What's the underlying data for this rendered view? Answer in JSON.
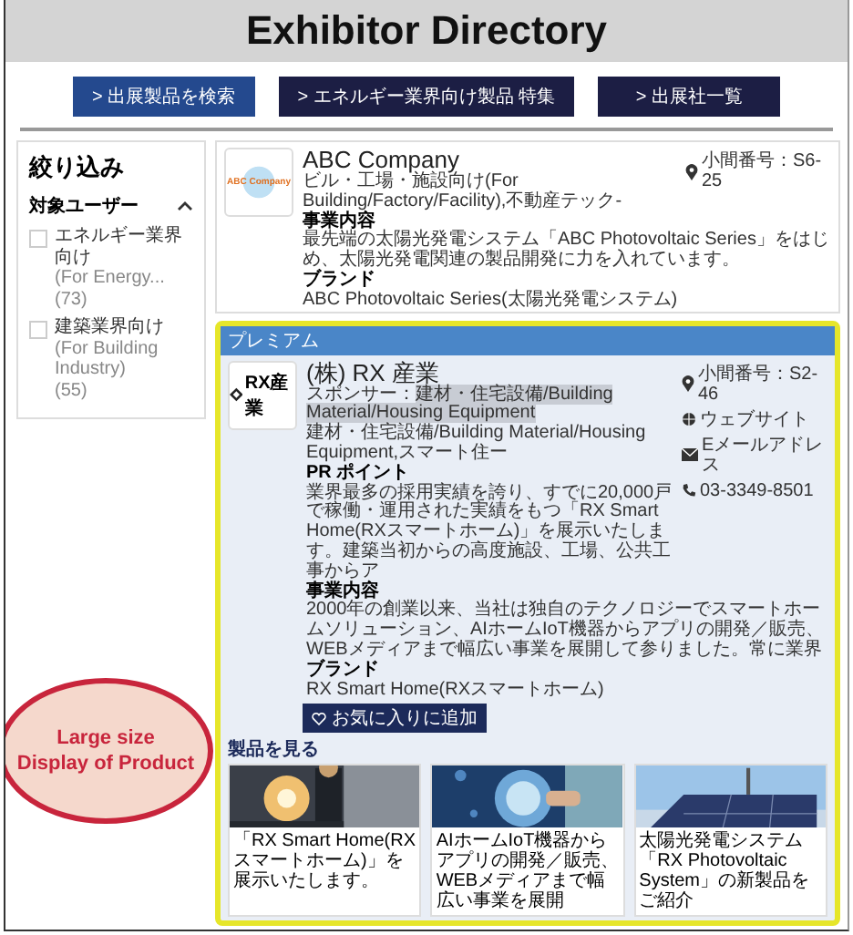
{
  "header": {
    "title": "Exhibitor Directory"
  },
  "nav_buttons": [
    {
      "label": "> 出展製品を検索",
      "selected": true
    },
    {
      "label": "> エネルギー業界向け製品 特集",
      "selected": false
    },
    {
      "label": "> 出展社一覧",
      "selected": false
    }
  ],
  "filter": {
    "title": "絞り込み",
    "section": "対象ユーザー",
    "options": [
      {
        "label": "エネルギー業界向け",
        "sub": "(For Energy...",
        "count": "(73)",
        "checked": false
      },
      {
        "label": "建築業界向け",
        "sub": "(For Building Industry)",
        "count": "(55)",
        "checked": false
      }
    ]
  },
  "exhibitors": [
    {
      "kind": "standard",
      "logo": "ABC Company",
      "name": "ABC Company",
      "tags": "ビル・工場・施設向け(For Building/Factory/Facility),不動産テック-",
      "sections": [
        {
          "heading": "事業内容",
          "text": "最先端の太陽光発電システム「ABC Photovoltaic Series」をはじめ、太陽光発電関連の製品開発に力を入れています。"
        },
        {
          "heading": "ブランド",
          "text": "ABC Photovoltaic Series(太陽光発電システム)"
        }
      ],
      "contacts": [
        {
          "kind": "location",
          "text": "小間番号：S6-25"
        }
      ]
    },
    {
      "kind": "premium",
      "badge": "プレミアム",
      "logo": "RX産業",
      "name": "(株) RX 産業",
      "sponsor": {
        "label": "スポンサー：",
        "value": "建材・住宅設備/Building Material/Housing Equipment"
      },
      "tags": "建材・住宅設備/Building Material/Housing Equipment,スマート住ー",
      "sections": [
        {
          "heading": "PR ポイント",
          "text": "業界最多の採用実績を誇り、すでに20,000戸で稼働・運用された実績をもつ「RX Smart Home(RXスマートホーム)」を展示いたします。建築当初からの高度施設、工場、公共工事からア"
        },
        {
          "heading": "事業内容",
          "text": "2000年の創業以来、当社は独自のテクノロジーでスマートホームソリューション、AIホームIoT機器からアプリの開発／販売、WEBメディアまで幅広い事業を展開して参りました。常に業界"
        },
        {
          "heading": "ブランド",
          "text": "RX Smart Home(RXスマートホーム)"
        }
      ],
      "contacts": [
        {
          "kind": "location",
          "text": "小間番号：S2-46"
        },
        {
          "kind": "website",
          "text": "ウェブサイト"
        },
        {
          "kind": "email",
          "text": "Eメールアドレス"
        },
        {
          "kind": "phone",
          "text": "03-3349-8501"
        }
      ],
      "favorite_button": "お気に入りに追加",
      "products_heading": "製品を見る",
      "products": [
        {
          "caption": "「RX Smart Home(RXスマートホーム)」を展示いたします。"
        },
        {
          "caption": "AIホームIoT機器からアプリの開発／販売、WEBメディアまで幅広い事業を展開"
        },
        {
          "caption": "太陽光発電システム「RX Photovoltaic System」の新製品をご紹介"
        }
      ]
    }
  ],
  "callout": {
    "lines": [
      "Large size",
      "Display of Product"
    ]
  }
}
